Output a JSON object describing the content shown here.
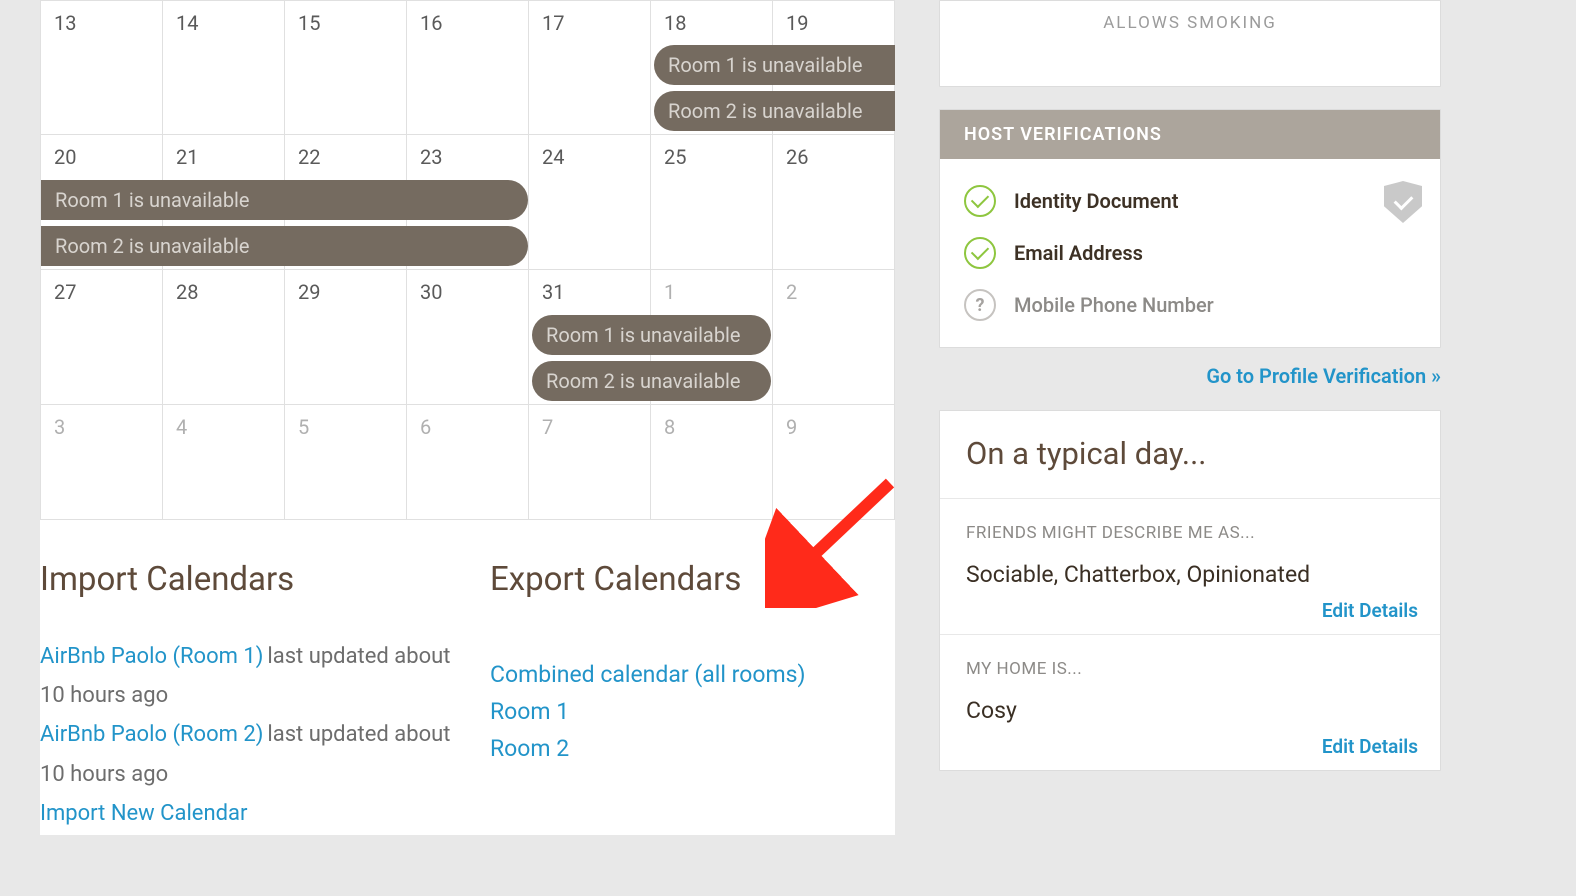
{
  "calendar": {
    "rows": [
      {
        "days": [
          "13",
          "14",
          "15",
          "16",
          "17",
          "18",
          "19"
        ],
        "other": []
      },
      {
        "days": [
          "20",
          "21",
          "22",
          "23",
          "24",
          "25",
          "26"
        ],
        "other": []
      },
      {
        "days": [
          "27",
          "28",
          "29",
          "30",
          "31",
          "1",
          "2"
        ],
        "other": [
          5,
          6
        ]
      },
      {
        "days": [
          "3",
          "4",
          "5",
          "6",
          "7",
          "8",
          "9"
        ],
        "other": [
          0,
          1,
          2,
          3,
          4,
          5,
          6
        ]
      }
    ],
    "events": {
      "r0_a": "Room 1 is unavailable",
      "r0_b": "Room 2 is unavailable",
      "r1_a": "Room 1 is unavailable",
      "r1_b": "Room 2 is unavailable",
      "r2_a": "Room 1 is unavailable",
      "r2_b": "Room 2 is unavailable"
    }
  },
  "import": {
    "heading": "Import Calendars",
    "link1": "AirBnb Paolo (Room 1)",
    "suffix1_a": "last updated about",
    "suffix1_b": "10 hours ago",
    "link2": "AirBnb Paolo (Room 2)",
    "suffix2_a": "last updated about",
    "suffix2_b": "10 hours ago",
    "new": "Import New Calendar"
  },
  "export": {
    "heading": "Export Calendars",
    "combined": "Combined calendar (all rooms)",
    "room1": "Room 1",
    "room2": "Room 2"
  },
  "sidebar": {
    "smoking": "ALLOWS SMOKING",
    "verif_head": "HOST VERIFICATIONS",
    "verif1": "Identity Document",
    "verif2": "Email Address",
    "verif3": "Mobile Phone Number",
    "profile_link": "Go to Profile Verification »",
    "typical_head": "On a typical day...",
    "describe_label": "FRIENDS MIGHT DESCRIBE ME AS...",
    "describe_val": "Sociable, Chatterbox, Opinionated",
    "home_label": "MY HOME IS...",
    "home_val": "Cosy",
    "edit": "Edit Details"
  }
}
